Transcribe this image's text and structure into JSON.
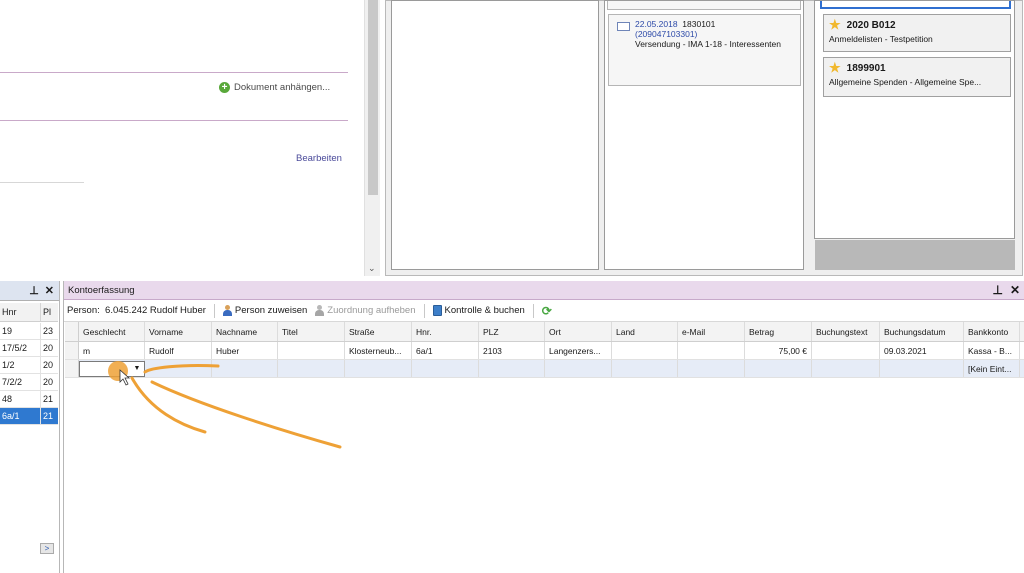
{
  "top_left": {
    "attach_label": "Dokument anhängen...",
    "edit_label": "Bearbeiten"
  },
  "messages": {
    "item": {
      "date": "22.05.2018",
      "id": "1830101",
      "ref": "(209047103301)",
      "text": "Versendung - IMA 1-18 - Interessenten"
    }
  },
  "tasks": [
    {
      "title": "2020 B012",
      "subtitle": "Anmeldelisten - Testpetition"
    },
    {
      "title": "1899901",
      "subtitle": "Allgemeine Spenden - Allgemeine Spe..."
    }
  ],
  "left_dock": {
    "pin": "q",
    "close": "✕",
    "columns": [
      "Hnr",
      "Pl"
    ],
    "rows": [
      [
        "19",
        "23"
      ],
      [
        "17/5/2",
        "20"
      ],
      [
        "1/2",
        "20"
      ],
      [
        "7/2/2",
        "20"
      ],
      [
        "48",
        "21"
      ],
      [
        "6a/1",
        "21"
      ]
    ],
    "selected_row": 5
  },
  "main_dock": {
    "title": "Kontoerfassung",
    "toolbar": {
      "person_label": "Person:",
      "person_value": "6.045.242 Rudolf Huber",
      "assign_label": "Person zuweisen",
      "unassign_label": "Zuordnung aufheben",
      "check_book_label": "Kontrolle & buchen"
    },
    "columns": [
      "Geschlecht",
      "Vorname",
      "Nachname",
      "Titel",
      "Straße",
      "Hnr.",
      "PLZ",
      "Ort",
      "Land",
      "e-Mail",
      "Betrag",
      "Buchungstext",
      "Buchungsdatum",
      "Bankkonto"
    ],
    "rows": [
      [
        "m",
        "Rudolf",
        "Huber",
        "",
        "Klosterneub...",
        "6a/1",
        "2103",
        "Langenzers...",
        "",
        "",
        "75,00 €",
        "",
        "09.03.2021",
        "Kassa - B..."
      ],
      [
        "",
        "",
        "",
        "",
        "",
        "",
        "",
        "",
        "",
        "",
        "",
        "",
        "",
        "[Kein Eint..."
      ]
    ]
  },
  "colors": {
    "main_titlebar": "#e9d9ec",
    "selection": "#2f79d0",
    "annotation": "#eea136"
  }
}
